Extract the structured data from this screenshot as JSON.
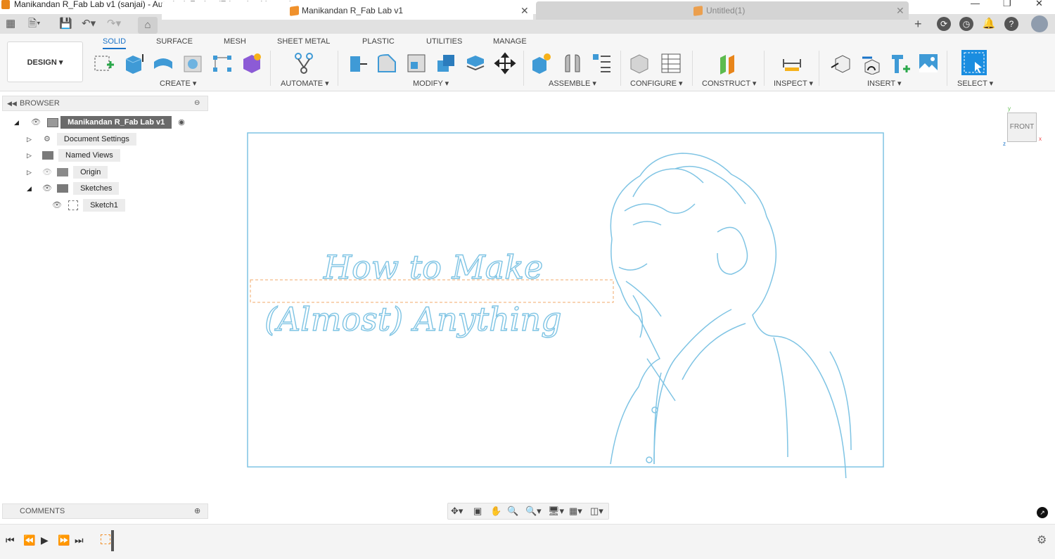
{
  "window": {
    "title": "Manikandan R_Fab Lab v1 (sanjai) - Autodesk Fusion (Education License)"
  },
  "tabs": [
    {
      "label": "Manikandan R_Fab Lab v1",
      "active": true
    },
    {
      "label": "Untitled(1)",
      "active": false
    }
  ],
  "toolbar": {
    "design_label": "DESIGN ▾",
    "workspace_tabs": [
      "SOLID",
      "SURFACE",
      "MESH",
      "SHEET METAL",
      "PLASTIC",
      "UTILITIES",
      "MANAGE"
    ],
    "selected_tab": "SOLID",
    "groups": [
      "CREATE ▾",
      "AUTOMATE ▾",
      "MODIFY ▾",
      "ASSEMBLE ▾",
      "CONFIGURE ▾",
      "CONSTRUCT ▾",
      "INSPECT ▾",
      "INSERT ▾",
      "SELECT ▾"
    ]
  },
  "browser": {
    "title": "BROWSER",
    "root": "Manikandan R_Fab Lab v1",
    "items": [
      "Document Settings",
      "Named Views",
      "Origin",
      "Sketches",
      "Sketch1"
    ]
  },
  "canvas": {
    "text_line1": "How to Make",
    "text_line2": "(Almost) Anything",
    "viewcube_label": "FRONT"
  },
  "comments": {
    "title": "COMMENTS"
  },
  "colors": {
    "accent": "#1a73c8",
    "sketch": "#7fc4e4",
    "orange": "#f0912c"
  }
}
